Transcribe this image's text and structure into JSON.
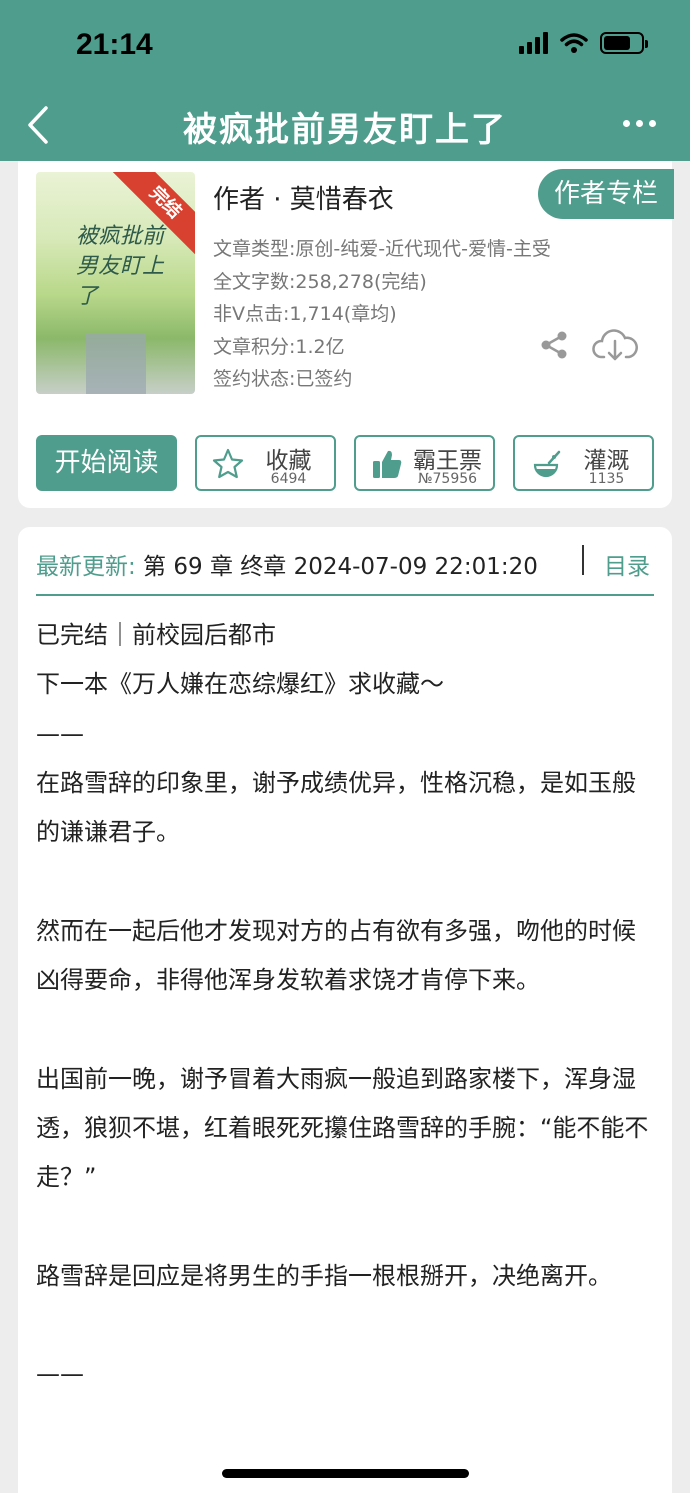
{
  "status": {
    "time": "21:14"
  },
  "nav": {
    "title": "被疯批前男友盯上了"
  },
  "book": {
    "cover_badge": "完结",
    "cover_title": "被疯批前男友盯上了",
    "author": "作者 · 莫惜春衣",
    "author_button": "作者专栏",
    "meta": [
      "文章类型:原创-纯爱-近代现代-爱情-主受",
      "全文字数:258,278(完结)",
      "非Ⅴ点击:1,714(章均)",
      "文章积分:1.2亿",
      "签约状态:已签约"
    ]
  },
  "actions": {
    "read": "开始阅读",
    "collect_label": "收藏",
    "collect_count": "6494",
    "ticket_label": "霸王票",
    "ticket_count": "№75956",
    "water_label": "灌溉",
    "water_count": "1135"
  },
  "update": {
    "key": "最新更新:",
    "value": " 第 69 章  终章 2024-07-09 22:01:20",
    "toc": "目录"
  },
  "description": [
    "已完结｜前校园后都市",
    "下一本《万人嫌在恋综爆红》求收藏～",
    "——",
    "在路雪辞的印象里，谢予成绩优异，性格沉稳，是如玉般的谦谦君子。",
    " ",
    "然而在一起后他才发现对方的占有欲有多强，吻他的时候凶得要命，非得他浑身发软着求饶才肯停下来。",
    " ",
    "出国前一晚，谢予冒着大雨疯一般追到路家楼下，浑身湿透，狼狈不堪，红着眼死死攥住路雪辞的手腕：“能不能不走？”",
    " ",
    "路雪辞是回应是将男生的手指一根根掰开，决绝离开。",
    " ",
    "——"
  ]
}
